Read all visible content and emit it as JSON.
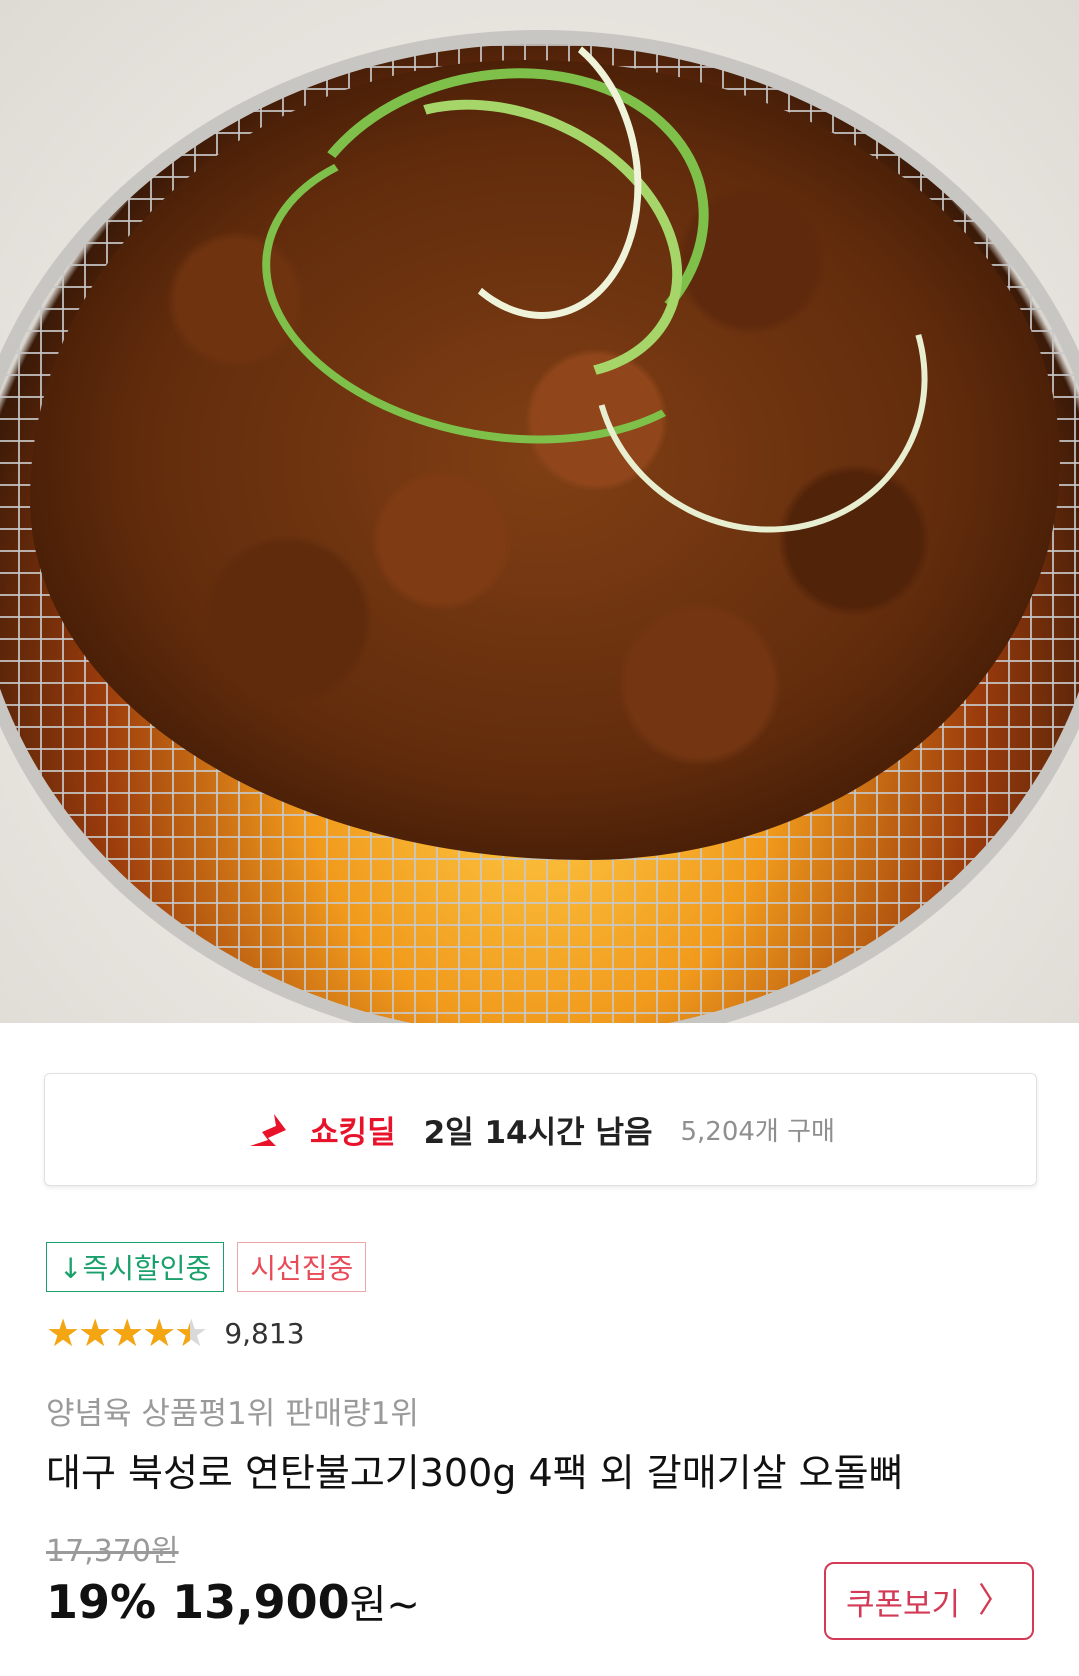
{
  "deal": {
    "label": "쇼킹딜",
    "time_left": "2일 14시간 남음",
    "purchase_count": "5,204개 구매",
    "accent_color": "#e8132b"
  },
  "badges": {
    "discount": "↓즉시할인중",
    "focus": "시선집중"
  },
  "rating": {
    "score_fraction": 0.9,
    "stars_glyphs": "★★★★★",
    "review_count": "9,813"
  },
  "product": {
    "subtitle": "양념육 상품평1위 판매량1위",
    "title": "대구 북성로 연탄불고기300g 4팩 외 갈매기살 오돌뼈",
    "original_price": "17,370원",
    "discount_rate": "19%",
    "price": "13,900",
    "price_suffix": "원~"
  },
  "coupon": {
    "label": "쿠폰보기",
    "chevron": "〉",
    "color": "#d23a55"
  }
}
